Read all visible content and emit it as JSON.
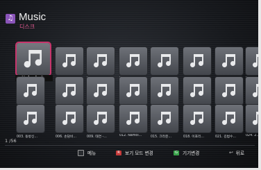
{
  "header": {
    "title": "Music",
    "subtitle": "디스크"
  },
  "tiles": [
    {
      "label": "~ Nobody.1",
      "selected": true
    },
    {
      "label": "006. 브라운..."
    },
    {
      "label": "007. M.C T..."
    },
    {
      "label": "010. Big Ba..."
    },
    {
      "label": "013. 환히 -..."
    },
    {
      "label": "016. 정규이..."
    },
    {
      "label": "019. 박명크..."
    },
    {
      "label": "022. 0..."
    },
    {
      "label": "002. 비 - L..."
    },
    {
      "label": "005. 에픽하..."
    },
    {
      "label": "008. 세이크..."
    },
    {
      "label": "011. 브라운..."
    },
    {
      "label": "014. 박명 -..."
    },
    {
      "label": "017. 포맨 -..."
    },
    {
      "label": "020. 2PM -..."
    },
    {
      "label": "023. ..."
    },
    {
      "label": "003. 동방신..."
    },
    {
      "label": "006. 손담비..."
    },
    {
      "label": "009. 태연 -..."
    },
    {
      "label": "012. Namol..."
    },
    {
      "label": "015. 크라운..."
    },
    {
      "label": "018. 이효리..."
    },
    {
      "label": "021. 김범수..."
    },
    {
      "label": "024. 2..."
    }
  ],
  "pagination": {
    "label": "1 /56"
  },
  "footer": {
    "menu_label": "메뉴",
    "red_key": "R",
    "view_label": "보기 모드 변경",
    "green_key": "G",
    "device_label": "기기변경",
    "back_label": "뒤로"
  },
  "colors": {
    "accent": "#c8346b",
    "red": "#c63a3a",
    "green": "#3aa34b",
    "app_icon": "#8a54b9"
  }
}
